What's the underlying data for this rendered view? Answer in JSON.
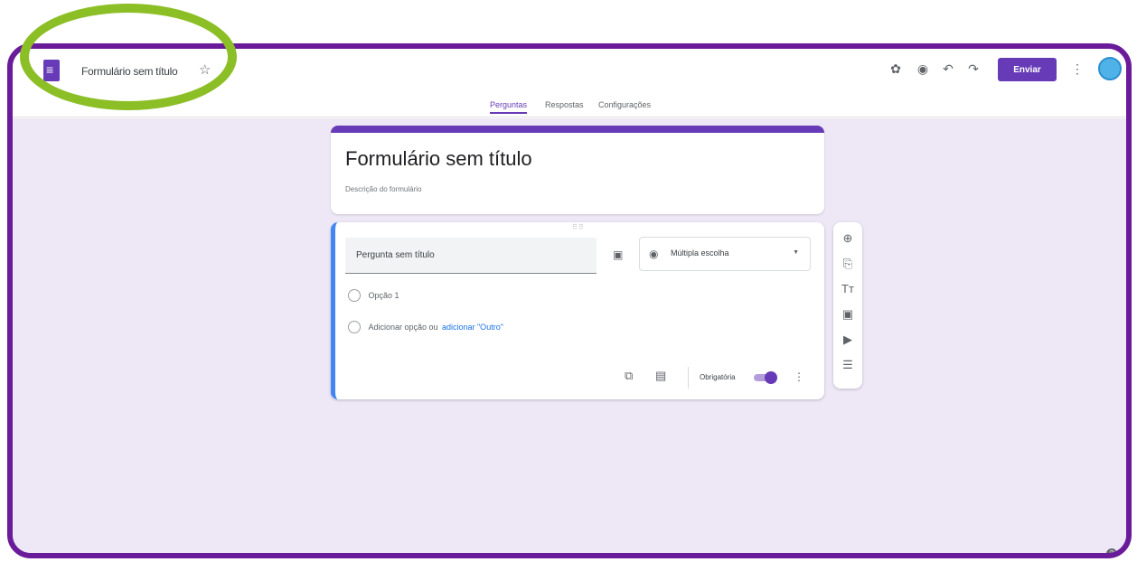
{
  "header": {
    "doc_title": "Formulário sem título",
    "send_label": "Enviar"
  },
  "tabs": [
    {
      "label": "Perguntas",
      "active": true
    },
    {
      "label": "Respostas",
      "active": false
    },
    {
      "label": "Configurações",
      "active": false
    }
  ],
  "form": {
    "title": "Formulário sem título",
    "description": "Descrição do formulário"
  },
  "question": {
    "text": "Pergunta sem título",
    "type": "Múltipla escolha",
    "options": [
      "Opção 1"
    ],
    "add_option_text": "Adicionar opção ou",
    "add_other_link": "adicionar \"Outro\"",
    "required_label": "Obrigatória",
    "required_on": true
  },
  "colors": {
    "accent": "#673ab7",
    "frame": "#6a1b9a",
    "highlight": "#8cbf26",
    "background": "#ede7f6"
  }
}
